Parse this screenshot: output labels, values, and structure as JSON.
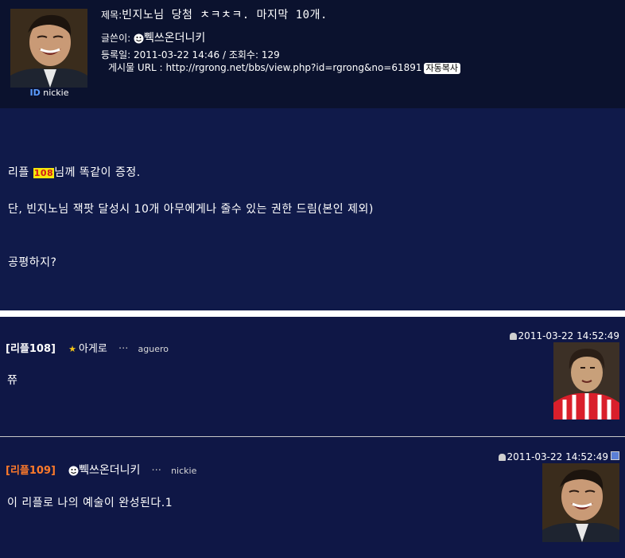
{
  "post": {
    "title_label": "제목:",
    "title": "빈지노님  당첨  ㅊㅋㅊㅋ.  마지막  10개.",
    "author_label": "글쓴이:",
    "author": "쀅쓰온더니키",
    "date_label": "등록일:",
    "date": "2011-03-22 14:46",
    "views_label": "조회수:",
    "views": "129",
    "url_label": "게시물 URL :",
    "url": "http://rgrong.net/bbs/view.php?id=rgrong&no=61891",
    "copy_button": "자동복사",
    "id_label": "ID",
    "user_id": "nickie"
  },
  "body": {
    "line1_pre": "리플 ",
    "line1_highlight": "108",
    "line1_post": "님께  똑같이  증정.",
    "line2": "단,  빈지노님  잭팟  달성시  10개  아무에게나  줄수  있는  권한  드림(본인  제외)",
    "line3": "공평하지?"
  },
  "comments": [
    {
      "label": "[리플108]",
      "nick": "아게로",
      "dots": "···",
      "user_id": "aguero",
      "date": "2011-03-22 14:52:49",
      "text": "쮸",
      "label_color": "#ffffff"
    },
    {
      "label": "[리플109]",
      "nick": "쀅쓰온더니키",
      "dots": "···",
      "user_id": "nickie",
      "date": "2011-03-22 14:52:49",
      "text": "이  리플로  나의  예술이  완성된다.1",
      "label_color": "#ff7a2a"
    }
  ],
  "colors": {
    "header_bg": "#0b122e",
    "body_bg": "#101a4a",
    "highlight_bg": "#f5e60a",
    "highlight_text": "#d21a1a",
    "id_tag": "#5b9cff"
  }
}
